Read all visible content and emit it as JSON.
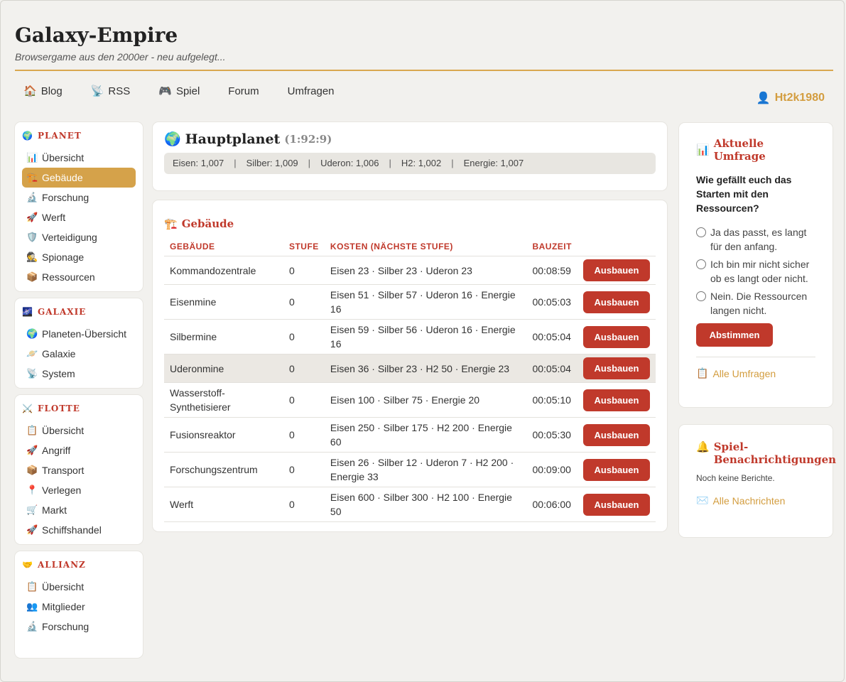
{
  "site": {
    "title": "Galaxy-Empire",
    "subtitle": "Browsergame aus den 2000er - neu aufgelegt..."
  },
  "topnav": [
    {
      "icon": "🏠",
      "label": "Blog"
    },
    {
      "icon": "📡",
      "label": "RSS"
    },
    {
      "icon": "🎮",
      "label": "Spiel"
    },
    {
      "icon": "",
      "label": "Forum"
    },
    {
      "icon": "",
      "label": "Umfragen"
    }
  ],
  "user": {
    "icon": "👤",
    "name": "Ht2k1980"
  },
  "sidebar": {
    "planet": {
      "heading": "PLANET",
      "icon": "🌍",
      "items": [
        {
          "icon": "📊",
          "label": "Übersicht"
        },
        {
          "icon": "🏗️",
          "label": "Gebäude"
        },
        {
          "icon": "🔬",
          "label": "Forschung"
        },
        {
          "icon": "🚀",
          "label": "Werft"
        },
        {
          "icon": "🛡️",
          "label": "Verteidigung"
        },
        {
          "icon": "🕵️",
          "label": "Spionage"
        },
        {
          "icon": "📦",
          "label": "Ressourcen"
        }
      ]
    },
    "galaxie": {
      "heading": "GALAXIE",
      "icon": "🌌",
      "items": [
        {
          "icon": "🌍",
          "label": "Planeten-Übersicht"
        },
        {
          "icon": "🪐",
          "label": "Galaxie"
        },
        {
          "icon": "📡",
          "label": "System"
        }
      ]
    },
    "flotte": {
      "heading": "FLOTTE",
      "icon": "⚔️",
      "items": [
        {
          "icon": "📋",
          "label": "Übersicht"
        },
        {
          "icon": "🚀",
          "label": "Angriff"
        },
        {
          "icon": "📦",
          "label": "Transport"
        },
        {
          "icon": "📍",
          "label": "Verlegen"
        },
        {
          "icon": "🛒",
          "label": "Markt"
        },
        {
          "icon": "🚀",
          "label": "Schiffshandel"
        }
      ]
    },
    "allianz": {
      "heading": "ALLIANZ",
      "icon": "🤝",
      "items": [
        {
          "icon": "📋",
          "label": "Übersicht"
        },
        {
          "icon": "👥",
          "label": "Mitglieder"
        },
        {
          "icon": "🔬",
          "label": "Forschung"
        }
      ]
    }
  },
  "planet": {
    "icon": "🌍",
    "name": "Hauptplanet",
    "coords": "(1:92:9)",
    "resources": [
      "Eisen: 1,007",
      "Silber: 1,009",
      "Uderon: 1,006",
      "H2: 1,002",
      "Energie: 1,007"
    ],
    "separator": "|"
  },
  "buildings": {
    "icon": "🏗️",
    "title": "Gebäude",
    "headers": [
      "GEBÄUDE",
      "STUFE",
      "KOSTEN (NÄCHSTE STUFE)",
      "BAUZEIT"
    ],
    "button_label": "Ausbauen",
    "rows": [
      {
        "name": "Kommandozentrale",
        "level": "0",
        "cost": "Eisen 23 · Silber 23 · Uderon 23",
        "time": "00:08:59"
      },
      {
        "name": "Eisenmine",
        "level": "0",
        "cost": "Eisen 51 · Silber 57 · Uderon 16 · Energie 16",
        "time": "00:05:03"
      },
      {
        "name": "Silbermine",
        "level": "0",
        "cost": "Eisen 59 · Silber 56 · Uderon 16 · Energie 16",
        "time": "00:05:04"
      },
      {
        "name": "Uderonmine",
        "level": "0",
        "cost": "Eisen 36 · Silber 23 · H2 50 · Energie 23",
        "time": "00:05:04"
      },
      {
        "name": "Wasserstoff-Synthetisierer",
        "level": "0",
        "cost": "Eisen 100 · Silber 75 · Energie 20",
        "time": "00:05:10"
      },
      {
        "name": "Fusionsreaktor",
        "level": "0",
        "cost": "Eisen 250 · Silber 175 · H2 200 · Energie 60",
        "time": "00:05:30"
      },
      {
        "name": "Forschungszentrum",
        "level": "0",
        "cost": "Eisen 26 · Silber 12 · Uderon 7 · H2 200 · Energie 33",
        "time": "00:09:00"
      },
      {
        "name": "Werft",
        "level": "0",
        "cost": "Eisen 600 · Silber 300 · H2 100 · Energie 50",
        "time": "00:06:00"
      }
    ]
  },
  "poll": {
    "icon": "📊",
    "title": "Aktuelle Umfrage",
    "question": "Wie gefällt euch das Starten mit den Ressourcen?",
    "options": [
      "Ja das passt, es langt für den anfang.",
      "Ich bin mir nicht sicher ob es langt oder nicht.",
      "Nein. Die Ressourcen langen nicht."
    ],
    "vote_label": "Abstimmen",
    "all_icon": "📋",
    "all_label": "Alle Umfragen"
  },
  "notifications": {
    "icon": "🔔",
    "title": "Spiel-Benachrichtigungen",
    "empty_text": "Noch keine Berichte.",
    "all_icon": "✉️",
    "all_label": "Alle Nachrichten"
  }
}
